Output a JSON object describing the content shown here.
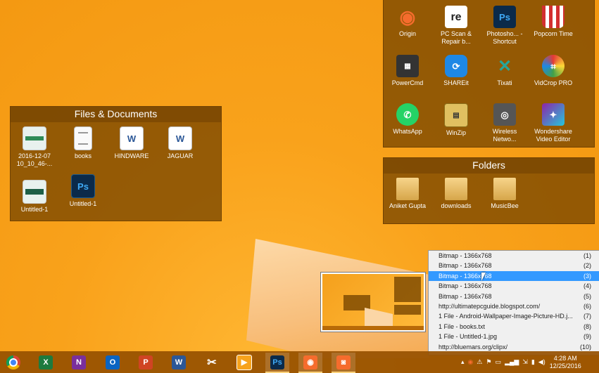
{
  "files_fence": {
    "title": "Files & Documents",
    "items": [
      {
        "label": "2016-12-07\n10_10_46-..."
      },
      {
        "label": "books"
      },
      {
        "label": "HINDWARE"
      },
      {
        "label": "JAGUAR"
      },
      {
        "label": "Untitled-1"
      },
      {
        "label": "Untitled-1"
      }
    ]
  },
  "apps_fence": {
    "items": [
      {
        "label": "Origin"
      },
      {
        "label": "PC Scan & Repair b..."
      },
      {
        "label": "Photosho... - Shortcut"
      },
      {
        "label": "Popcorn Time"
      },
      {
        "label": "PowerCmd"
      },
      {
        "label": "SHAREit"
      },
      {
        "label": "Tixati"
      },
      {
        "label": "VidCrop PRO"
      },
      {
        "label": "WhatsApp"
      },
      {
        "label": "WinZip"
      },
      {
        "label": "Wireless Netwo..."
      },
      {
        "label": "Wondershare Video Editor"
      }
    ]
  },
  "folders_fence": {
    "title": "Folders",
    "items": [
      {
        "label": "Aniket Gupta"
      },
      {
        "label": "downloads"
      },
      {
        "label": "MusicBee"
      }
    ]
  },
  "clipboard_menu": {
    "items": [
      {
        "text": "Bitmap - 1366x768",
        "num": "(1)"
      },
      {
        "text": "Bitmap - 1366x768",
        "num": "(2)"
      },
      {
        "text": "Bitmap - 1366x768",
        "num": "(3)"
      },
      {
        "text": "Bitmap - 1366x768",
        "num": "(4)"
      },
      {
        "text": "Bitmap - 1366x768",
        "num": "(5)"
      },
      {
        "text": "http://ultimatepcguide.blogspot.com/",
        "num": "(6)"
      },
      {
        "text": "1 File - Android-Wallpaper-Image-Picture-HD.j...",
        "num": "(7)"
      },
      {
        "text": "1 File - books.txt",
        "num": "(8)"
      },
      {
        "text": "1 File - Untitled-1.jpg",
        "num": "(9)"
      },
      {
        "text": "http://bluemars.org/clipx/",
        "num": "(10)"
      }
    ]
  },
  "taskbar": {
    "apps": [
      {
        "icon": "chrome-icon",
        "glyph": "●",
        "color": "#4285f4"
      },
      {
        "icon": "excel-icon",
        "glyph": "X",
        "color": "#1d7a3e"
      },
      {
        "icon": "onenote-icon",
        "glyph": "N",
        "color": "#7a2f9c"
      },
      {
        "icon": "outlook-icon",
        "glyph": "O",
        "color": "#0a64c2"
      },
      {
        "icon": "powerpoint-icon",
        "glyph": "P",
        "color": "#d04423"
      },
      {
        "icon": "word-icon",
        "glyph": "W",
        "color": "#2b5797"
      },
      {
        "icon": "snipping-tool-icon",
        "glyph": "✂",
        "color": "#6d6d6d"
      },
      {
        "icon": "media-player-icon",
        "glyph": "▶",
        "color": "#f7a31c"
      },
      {
        "icon": "photoshop-icon",
        "glyph": "Ps",
        "color": "#0b2a4a"
      },
      {
        "icon": "origin-icon",
        "glyph": "◉",
        "color": "#f56c2d"
      },
      {
        "icon": "camera-icon",
        "glyph": "◙",
        "color": "#f56c2d"
      }
    ],
    "clock_time": "4:28 AM",
    "clock_date": "12/25/2016"
  }
}
